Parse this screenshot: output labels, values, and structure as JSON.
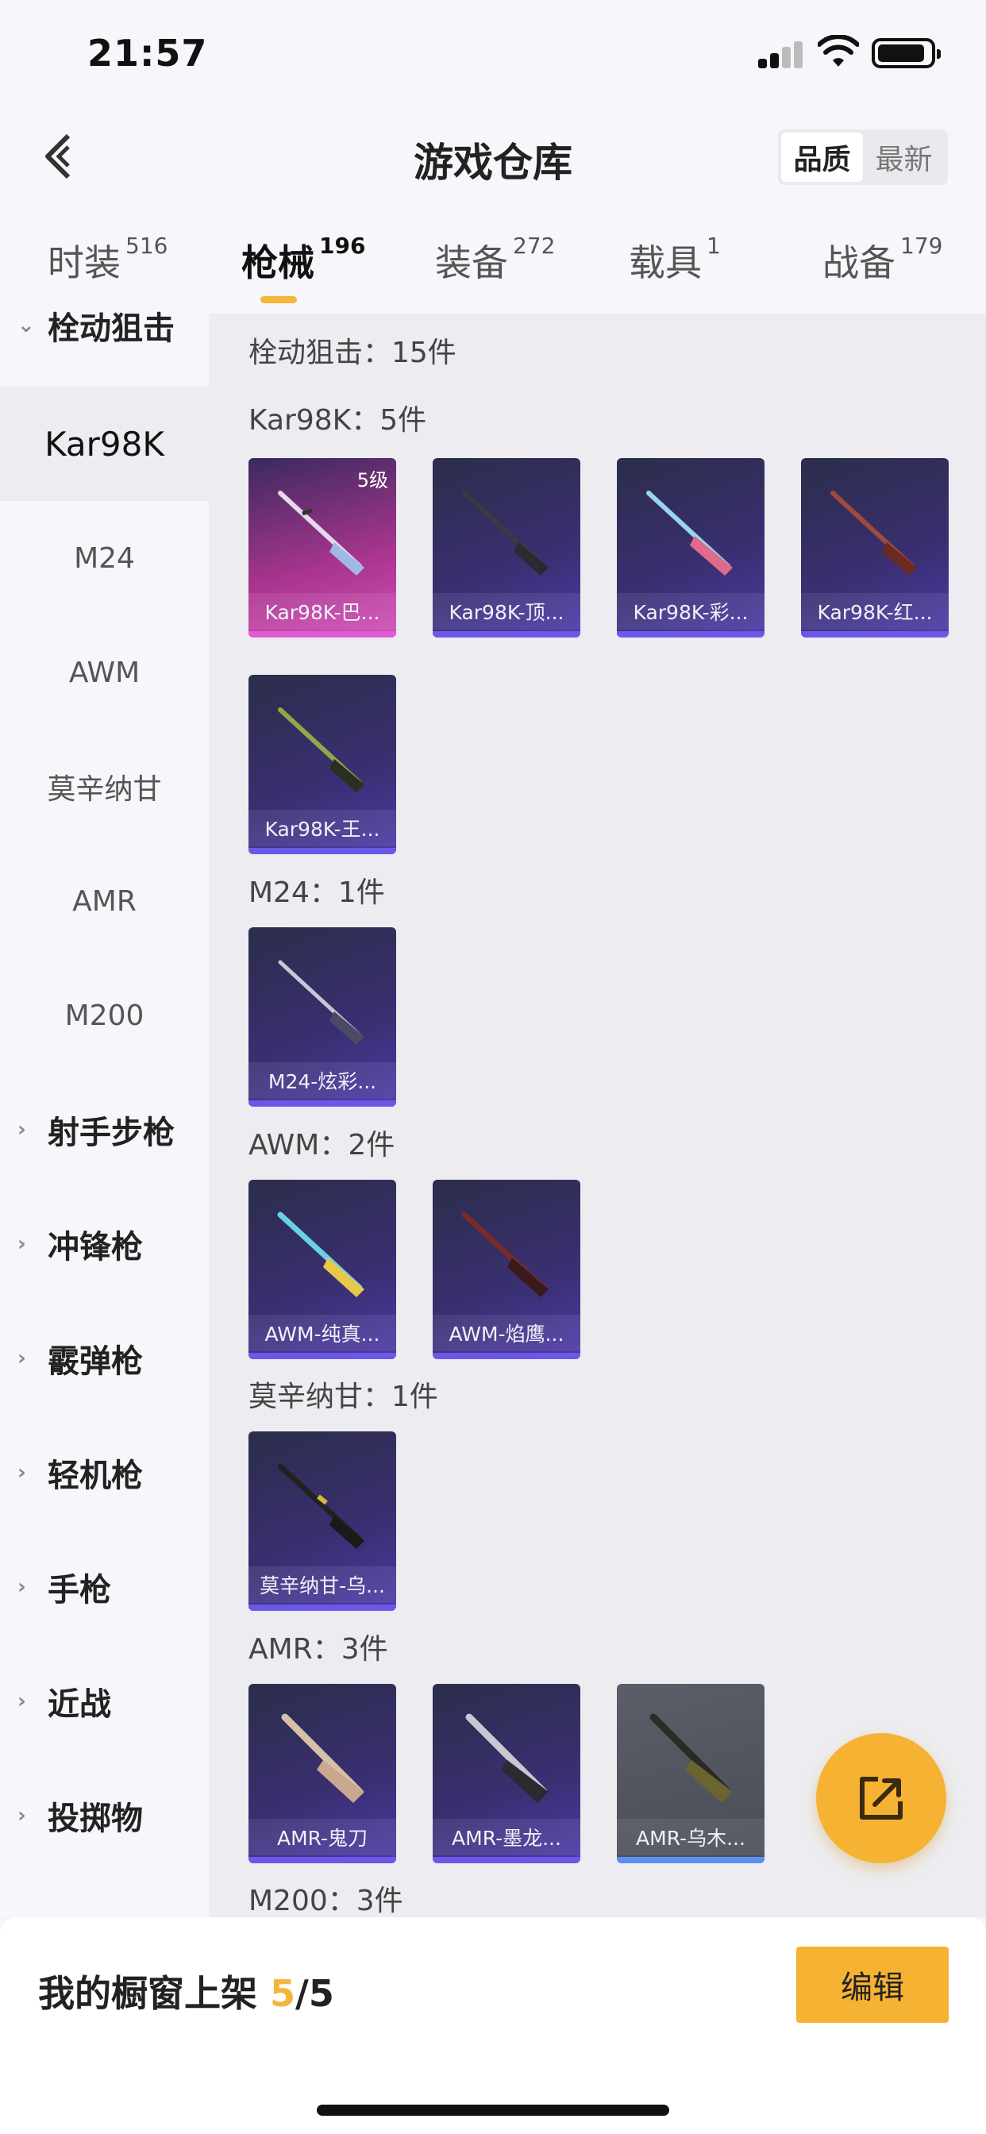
{
  "status": {
    "time": "21:57"
  },
  "header": {
    "title": "游戏仓库",
    "sort_quality": "品质",
    "sort_newest": "最新"
  },
  "tabs": [
    {
      "label": "时装",
      "count": "516"
    },
    {
      "label": "枪械",
      "count": "196"
    },
    {
      "label": "装备",
      "count": "272"
    },
    {
      "label": "载具",
      "count": "1"
    },
    {
      "label": "战备",
      "count": "179"
    }
  ],
  "sidebar": {
    "items": [
      {
        "label": "栓动狙击",
        "type": "category",
        "expanded": true
      },
      {
        "label": "Kar98K",
        "type": "sub",
        "selected": true
      },
      {
        "label": "M24",
        "type": "sub"
      },
      {
        "label": "AWM",
        "type": "sub"
      },
      {
        "label": "莫辛纳甘",
        "type": "sub"
      },
      {
        "label": "AMR",
        "type": "sub"
      },
      {
        "label": "M200",
        "type": "sub"
      },
      {
        "label": "射手步枪",
        "type": "category"
      },
      {
        "label": "冲锋枪",
        "type": "category"
      },
      {
        "label": "霰弹枪",
        "type": "category"
      },
      {
        "label": "轻机枪",
        "type": "category"
      },
      {
        "label": "手枪",
        "type": "category"
      },
      {
        "label": "近战",
        "type": "category"
      },
      {
        "label": "投掷物",
        "type": "category"
      }
    ]
  },
  "content": {
    "category_header": "栓动狙击：15件",
    "groups": [
      {
        "header": "Kar98K：5件",
        "items": [
          {
            "label": "Kar98K-巴...",
            "level": "5级",
            "quality": "pink"
          },
          {
            "label": "Kar98K-顶...",
            "quality": "purple"
          },
          {
            "label": "Kar98K-彩...",
            "quality": "purple"
          },
          {
            "label": "Kar98K-红...",
            "quality": "purple"
          },
          {
            "label": "Kar98K-王...",
            "quality": "purple"
          }
        ]
      },
      {
        "header": "M24：1件",
        "items": [
          {
            "label": "M24-炫彩...",
            "quality": "purple"
          }
        ]
      },
      {
        "header": "AWM：2件",
        "items": [
          {
            "label": "AWM-纯真...",
            "quality": "purple"
          },
          {
            "label": "AWM-焰鹰...",
            "quality": "purple"
          }
        ]
      },
      {
        "header": "莫辛纳甘：1件",
        "items": [
          {
            "label": "莫辛纳甘-乌...",
            "quality": "purple"
          }
        ]
      },
      {
        "header": "AMR：3件",
        "items": [
          {
            "label": "AMR-鬼刀",
            "quality": "purple"
          },
          {
            "label": "AMR-墨龙...",
            "quality": "purple"
          },
          {
            "label": "AMR-乌木...",
            "quality": "gray"
          }
        ]
      },
      {
        "header": "M200：3件",
        "items": []
      }
    ]
  },
  "bottom": {
    "shelf_label": "我的橱窗上架",
    "shelf_used": "5",
    "shelf_total": "/5",
    "edit_label": "编辑"
  },
  "colors": {
    "accent": "#f6b233",
    "purple_bar": "#6a59e8",
    "pink_bar": "#e05bd3",
    "blue_bar": "#5b8ef0"
  },
  "icons": [
    "back-chevron-icon",
    "signal-icon",
    "wifi-icon",
    "battery-icon",
    "share-export-icon",
    "chevron-right-icon",
    "chevron-down-icon"
  ]
}
